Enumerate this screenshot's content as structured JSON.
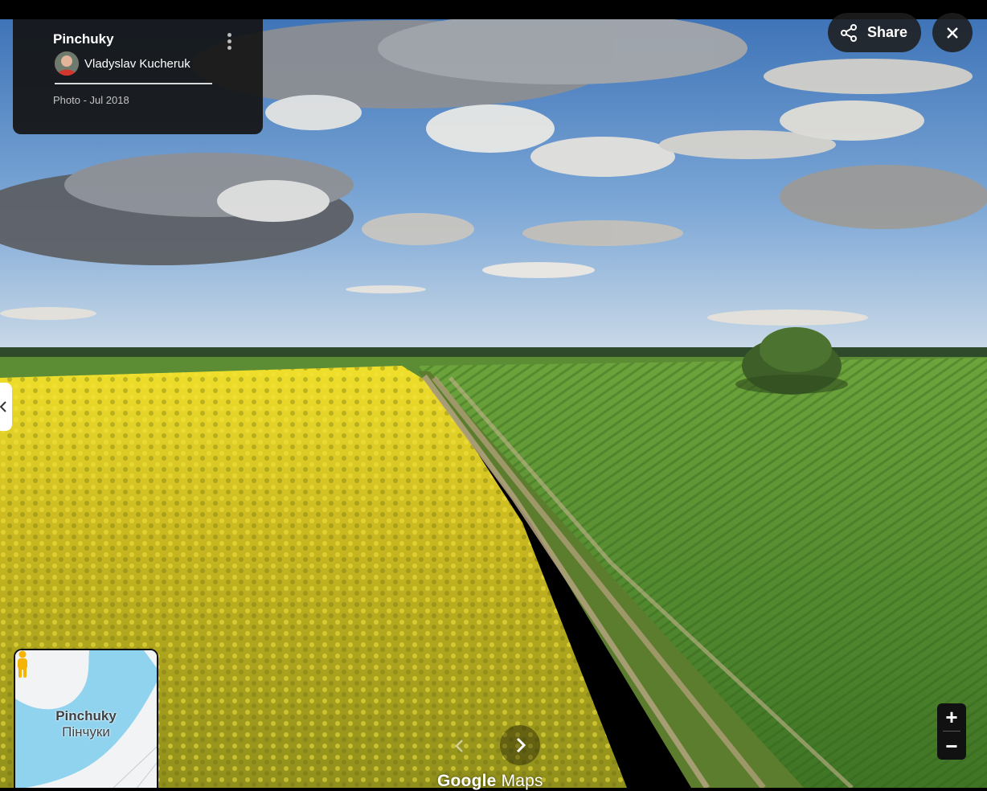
{
  "viewer": {
    "place_name": "Pinchuky",
    "author": "Vladyslav Kucheruk",
    "meta": "Photo - Jul 2018",
    "share_label": "Share"
  },
  "minimap": {
    "label_latin": "Pinchuky",
    "label_cyrillic": "Пінчуки"
  },
  "watermark": {
    "brand": "Google",
    "product": "Maps"
  },
  "zoom": {
    "in_symbol": "+",
    "out_symbol": "−"
  },
  "icons": {
    "kebab": "more-vert-icon",
    "share": "share-icon",
    "close": "close-icon",
    "collapse": "chevron-left-icon",
    "prev": "chevron-left-icon",
    "next": "chevron-right-icon",
    "pegman": "pegman-icon"
  },
  "colors": {
    "sky": "#5f8fc4",
    "sunflower": "#d8c21c",
    "corn": "#4f8a2c",
    "map_water": "#8fd3ee",
    "pegman": "#f4b400"
  }
}
